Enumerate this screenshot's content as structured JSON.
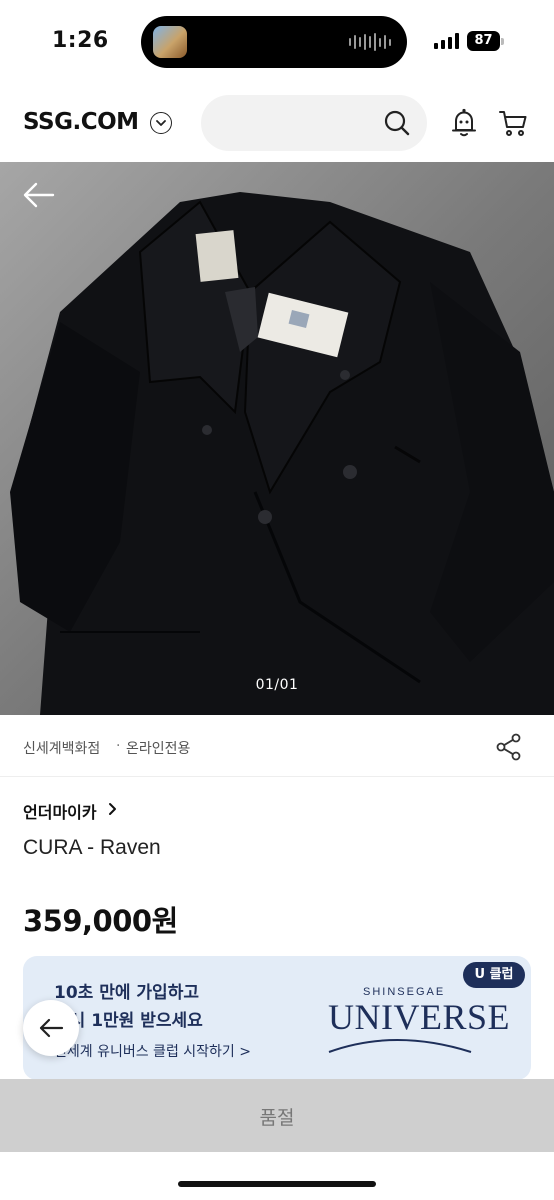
{
  "status_bar": {
    "time": "1:26",
    "battery": "87"
  },
  "header": {
    "logo": "SSG.COM"
  },
  "product_image": {
    "counter": "01/01"
  },
  "store": {
    "name": "신세계백화점",
    "separator": "·",
    "channel": "온라인전용"
  },
  "product": {
    "brand": "언더마이카",
    "name": "CURA - Raven",
    "price": "359,000원"
  },
  "banner": {
    "line1": "10초 만에 가입하고",
    "line2": "즉시 1만원 받으세요",
    "link": "신세계 유니버스 클럽 시작하기 >",
    "tag": "U 클럽",
    "brand_small": "SHINSEGAE",
    "brand_big": "UNIVERSE"
  },
  "bottom_bar": {
    "label": "품절"
  },
  "colors": {
    "banner_bg": "#e3ecf7",
    "banner_text": "#1e2f5a",
    "soldout_bg": "#cfcfcf"
  },
  "icons": [
    "search-icon",
    "bell-icon",
    "cart-icon",
    "back-arrow-icon",
    "share-icon",
    "chevron-right-icon",
    "chevron-down-icon"
  ]
}
